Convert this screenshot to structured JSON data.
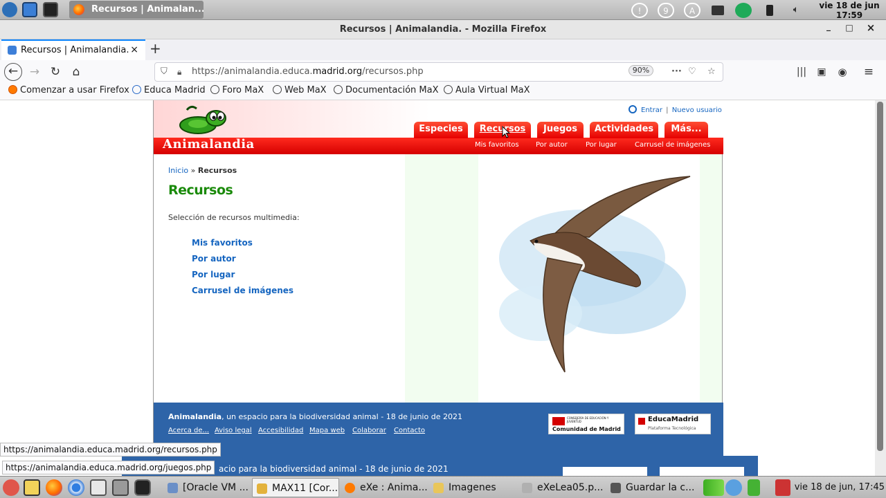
{
  "os_top": {
    "task_label": "Recursos | Animalan...",
    "clock_date": "vie 18 de jun",
    "clock_time": "17:59",
    "tray_badges": [
      "9",
      "A"
    ]
  },
  "window": {
    "title": "Recursos | Animalandia. - Mozilla Firefox",
    "minimize": "_",
    "maximize": "□",
    "close": "×"
  },
  "browser": {
    "tab_title": "Recursos | Animalandia.",
    "tab_close": "×",
    "new_tab": "+",
    "url_prefix": "https://animalandia.educa.",
    "url_domain": "madrid.org",
    "url_path": "/recursos.php",
    "zoom": "90%",
    "page_actions": "···",
    "bookmarks": [
      "Comenzar a usar Firefox",
      "Educa Madrid",
      "Foro MaX",
      "Web MaX",
      "Documentación MaX",
      "Aula Virtual MaX"
    ]
  },
  "site": {
    "logo_text": "Animalandia",
    "login": "Entrar",
    "login_sep": "|",
    "new_user": "Nuevo usuario",
    "menu_tabs": [
      "Especies",
      "Recursos",
      "Juegos",
      "Actividades",
      "Más..."
    ],
    "subnav": [
      "Mis favoritos",
      "Por autor",
      "Por lugar",
      "Carrusel de imágenes"
    ],
    "breadcrumb_home": "Inicio",
    "breadcrumb_sep": "»",
    "breadcrumb_current": "Recursos",
    "page_title": "Recursos",
    "intro": "Selección de recursos multimedia:",
    "resource_links": [
      "Mis favoritos",
      "Por autor",
      "Por lugar",
      "Carrusel de imágenes"
    ],
    "footer_brand": "Animalandia",
    "footer_tagline": ", un espacio para la biodiversidad animal - 18 de junio de 2021",
    "footer_links": [
      "Acerca de...",
      "Aviso legal",
      "Accesibilidad",
      "Mapa web",
      "Colaborar",
      "Contacto"
    ],
    "logo_cm_small": "CONSEJERÍA DE EDUCACIÓN Y JUVENTUD",
    "logo_cm": "Comunidad de Madrid",
    "logo_em": "EducaMadrid",
    "logo_em_sub": "Plataforma Tecnológica",
    "bg_footer_text": "acio para la biodiversidad animal - 18 de junio de 2021"
  },
  "status": {
    "hover_url_1": "https://animalandia.educa.madrid.org/recursos.php",
    "hover_url_2": "https://animalandia.educa.madrid.org/juegos.php"
  },
  "taskbar": {
    "tasks": [
      "[Oracle VM ...",
      "MAX11 [Cor...",
      "eXe : Anima...",
      "Imagenes",
      "eXeLea05.p...",
      "Guardar la c..."
    ],
    "clock": "vie 18 de jun, 17:45"
  },
  "colors": {
    "site_red": "#e60000",
    "title_green": "#1a8a0a",
    "link_blue": "#1565c0",
    "footer_blue": "#2e64a8"
  }
}
